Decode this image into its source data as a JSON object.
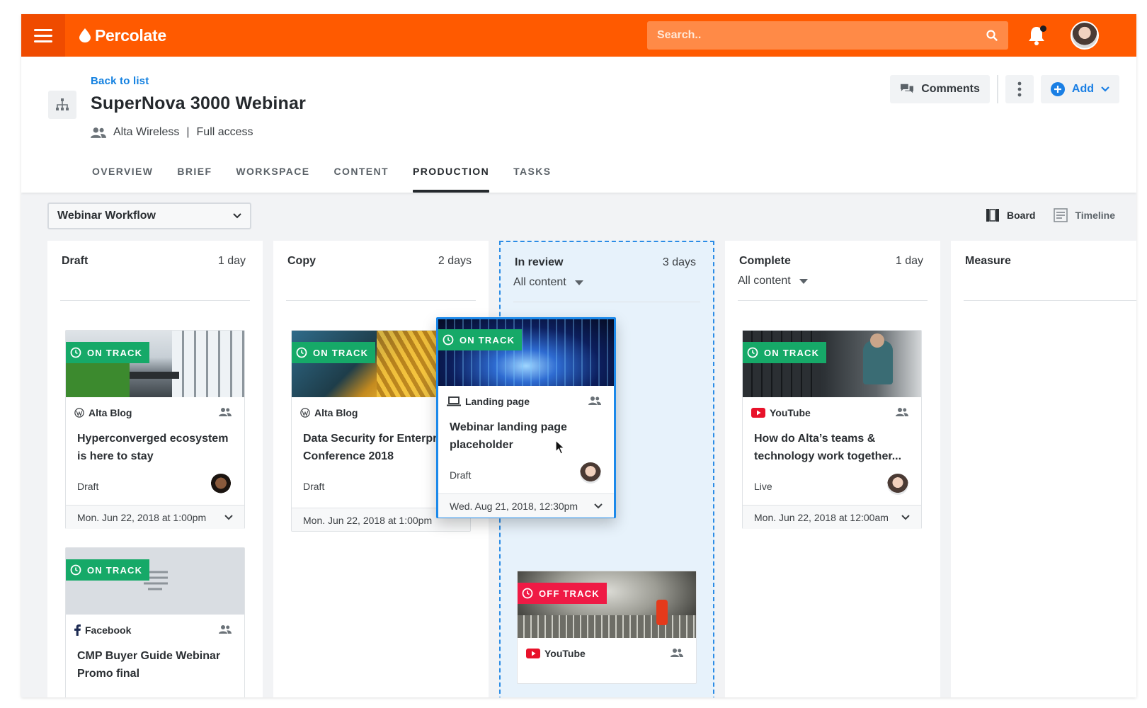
{
  "brand": {
    "name": "Percolate"
  },
  "search": {
    "placeholder": "Search.."
  },
  "project": {
    "back_label": "Back to list",
    "title": "SuperNova 3000 Webinar",
    "org": "Alta Wireless",
    "separator": "|",
    "access": "Full access"
  },
  "actions": {
    "comments": "Comments",
    "add": "Add"
  },
  "tabs": [
    "OVERVIEW",
    "BRIEF",
    "WORKSPACE",
    "CONTENT",
    "PRODUCTION",
    "TASKS"
  ],
  "toolbar": {
    "workflow": "Webinar Workflow",
    "board": "Board",
    "timeline": "Timeline"
  },
  "columns": [
    {
      "title": "Draft",
      "days": "1 day"
    },
    {
      "title": "Copy",
      "days": "2 days"
    },
    {
      "title": "In review",
      "days": "3 days",
      "filter": "All content"
    },
    {
      "title": "Complete",
      "days": "1 day",
      "filter": "All content"
    },
    {
      "title": "Measure",
      "days": ""
    }
  ],
  "cards": {
    "draft1": {
      "badge": "ON TRACK",
      "source": "Alta Blog",
      "title": "Hyperconverged ecosystem is here to stay",
      "status": "Draft",
      "due": "Mon. Jun 22, 2018 at 1:00pm"
    },
    "draft2": {
      "badge": "ON TRACK",
      "source": "Facebook",
      "title": "CMP Buyer Guide Webinar Promo final"
    },
    "copy1": {
      "badge": "ON TRACK",
      "source": "Alta Blog",
      "title": "Data Security for Enterprise Conference 2018",
      "status": "Draft",
      "due": "Mon. Jun 22, 2018 at 1:00pm"
    },
    "drag": {
      "badge": "ON TRACK",
      "source": "Landing page",
      "title": "Webinar landing page placeholder",
      "status": "Draft",
      "due": "Wed. Aug 21, 2018, 12:30pm"
    },
    "review2": {
      "badge": "OFF TRACK",
      "source": "YouTube"
    },
    "complete1": {
      "badge": "ON TRACK",
      "source": "YouTube",
      "title": "How do Alta’s teams & technology work together...",
      "status": "Live",
      "due": "Mon. Jun 22, 2018 at 12:00am"
    }
  },
  "colors": {
    "brand_orange": "#ff5a00",
    "on_track": "#16a968",
    "off_track": "#ef1a45",
    "link_blue": "#1280e0"
  }
}
